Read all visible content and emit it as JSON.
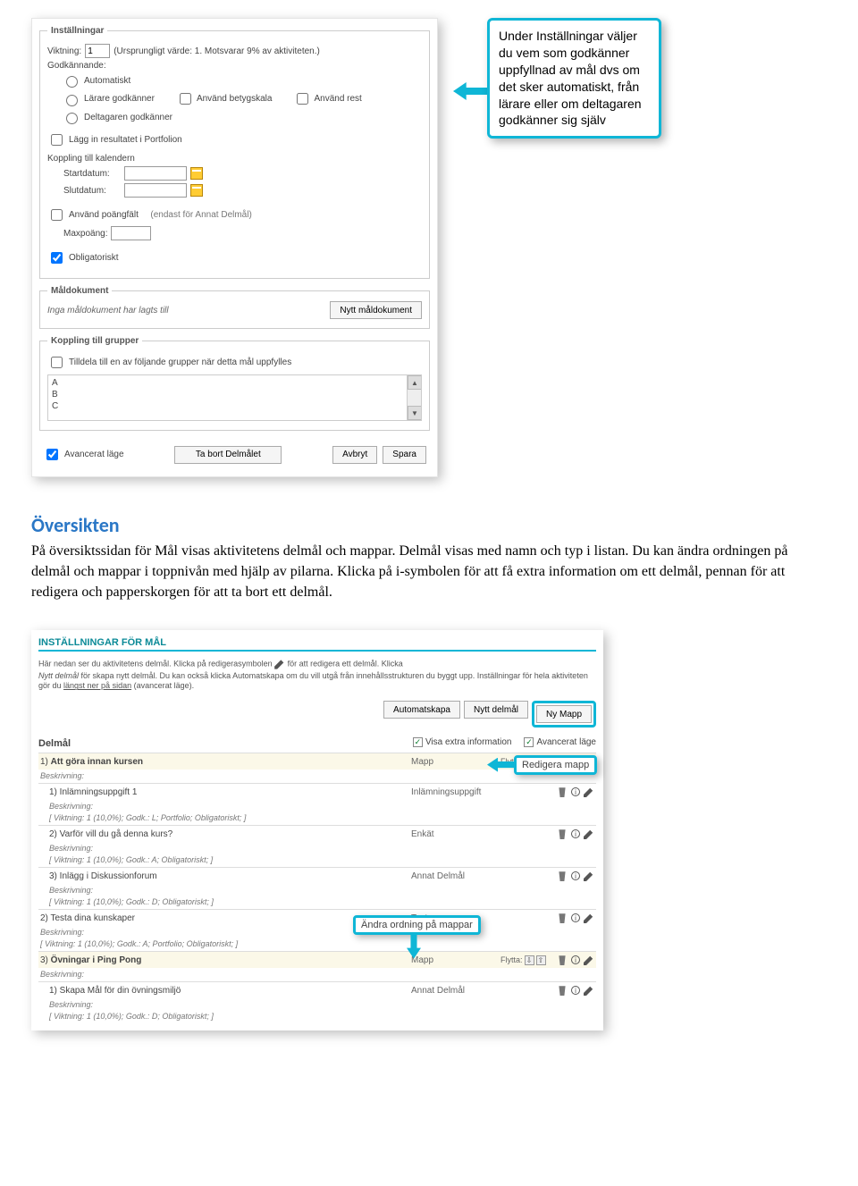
{
  "callouts": {
    "instruction": "Under Inställningar väljer du vem som godkänner uppfyllnad av mål dvs om det sker automatiskt, från lärare eller om deltagaren godkänner sig själv",
    "redigeraMapp": "Redigera mapp",
    "andraOrdning": "Ändra ordning på mappar"
  },
  "settings": {
    "legend": "Inställningar",
    "viktningLabel": "Viktning:",
    "viktningValue": "1",
    "viktningNote": "(Ursprungligt värde: 1. Motsvarar 9% av aktiviteten.)",
    "godkLabel": "Godkännande:",
    "radioAuto": "Automatiskt",
    "radioLarare": "Lärare godkänner",
    "radioDeltagare": "Deltagaren godkänner",
    "cbBetyg": "Använd betygskala",
    "cbRest": "Använd rest",
    "cbPortfolio": "Lägg in resultatet i Portfolion",
    "kopplingKal": "Koppling till kalendern",
    "startLabel": "Startdatum:",
    "slutLabel": "Slutdatum:",
    "cbPoang": "Använd poängfält",
    "poangNote": "(endast för Annat Delmål)",
    "maxpoangLabel": "Maxpoäng:",
    "cbObl": "Obligatoriskt"
  },
  "maldok": {
    "legend": "Måldokument",
    "empty": "Inga måldokument har lagts till",
    "btn": "Nytt måldokument"
  },
  "grupper": {
    "legend": "Koppling till grupper",
    "cbLabel": "Tilldela till en av följande grupper när detta mål uppfylles",
    "items": [
      "A",
      "B",
      "C"
    ]
  },
  "bottom": {
    "advLabel": "Avancerat läge",
    "btnRemove": "Ta bort Delmålet",
    "btnCancel": "Avbryt",
    "btnSave": "Spara"
  },
  "section": {
    "title": "Översikten",
    "p1": "På översiktssidan för Mål visas aktivitetens delmål och mappar. Delmål visas med namn och typ i listan. Du kan ändra ordningen på delmål och mappar i toppnivån med hjälp av pilarna. Klicka på i-symbolen för att få extra information om ett delmål, pennan för att redigera och papperskorgen för att ta bort ett delmål."
  },
  "s2": {
    "title": "INSTÄLLNINGAR FÖR MÅL",
    "intro1": "Här nedan ser du aktivitetens delmål. Klicka på redigerasymbolen ",
    "intro1b": " för att redigera ett delmål. Klicka",
    "intro2a": "Nytt delmål",
    "intro2b": " för skapa nytt delmål. Du kan också klicka Automatskapa om du vill utgå från innehållsstrukturen du byggt upp. Inställningar för hela aktiviteten gör du ",
    "intro2c": "längst ner på sidan",
    "intro2d": " (avancerat läge).",
    "btnAuto": "Automatskapa",
    "btnNytt": "Nytt delmål",
    "btnNyMapp": "Ny Mapp",
    "heading": "Delmål",
    "optExtra": "Visa extra information",
    "optAdv": "Avancerat läge",
    "flyttaLabel": "Flytta:",
    "descLabel": "Beskrivning:",
    "rows": [
      {
        "idx": "1)",
        "name": "Att göra innan kursen",
        "type": "Mapp",
        "mapp": true,
        "moveDown": true,
        "meta": ""
      },
      {
        "idx": "1)",
        "name": "Inlämningsuppgift 1",
        "type": "Inlämningsuppgift",
        "sub": true,
        "meta": "[ Viktning: 1 (10,0%); Godk.: L; Portfolio; Obligatoriskt; ]"
      },
      {
        "idx": "2)",
        "name": "Varför vill du gå denna kurs?",
        "type": "Enkät",
        "sub": true,
        "meta": "[ Viktning: 1 (10,0%); Godk.: A; Obligatoriskt; ]"
      },
      {
        "idx": "3)",
        "name": "Inlägg i Diskussionforum",
        "type": "Annat Delmål",
        "sub": true,
        "meta": "[ Viktning: 1 (10,0%); Godk.: D; Obligatoriskt; ]"
      },
      {
        "idx": "2)",
        "name": "Testa dina kunskaper",
        "type": "Test",
        "meta": "[ Viktning: 1 (10,0%); Godk.: A; Portfolio; Obligatoriskt; ]"
      },
      {
        "idx": "3)",
        "name": "Övningar i Ping Pong",
        "type": "Mapp",
        "mapp": true,
        "moveUp": true,
        "moveDown": true,
        "bold": true,
        "meta": ""
      },
      {
        "idx": "1)",
        "name": "Skapa Mål för din övningsmiljö",
        "type": "Annat Delmål",
        "sub": true,
        "meta": "[ Viktning: 1 (10,0%); Godk.: D; Obligatoriskt; ]"
      }
    ]
  }
}
